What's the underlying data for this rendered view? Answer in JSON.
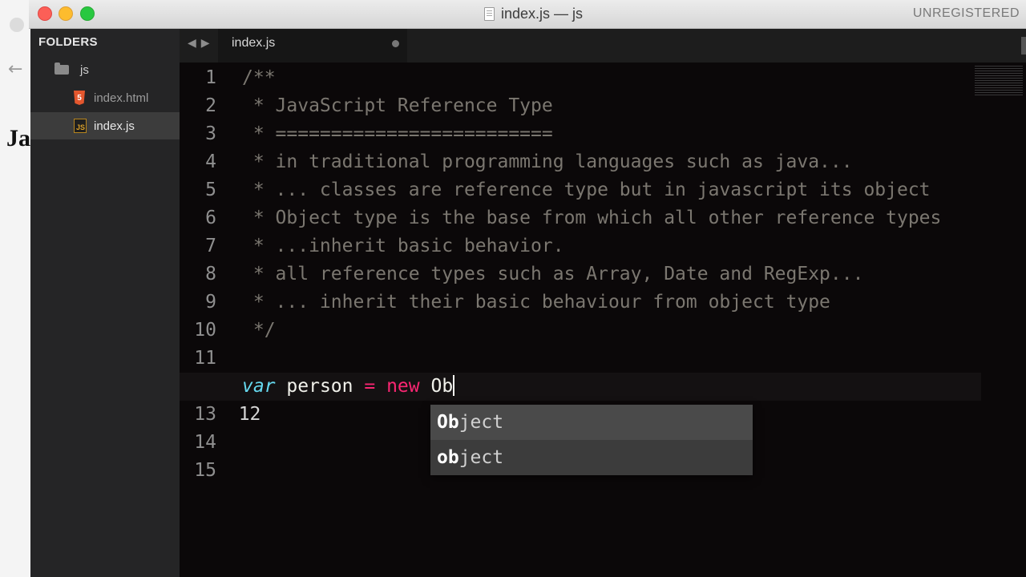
{
  "window": {
    "title": "index.js — js",
    "license_status": "UNREGISTERED"
  },
  "background": {
    "page_text": "Ja"
  },
  "sidebar": {
    "header": "FOLDERS",
    "items": [
      {
        "label": "js",
        "icon": "folder-icon"
      },
      {
        "label": "index.html",
        "icon": "html5-icon"
      },
      {
        "label": "index.js",
        "icon": "js-file-icon",
        "selected": true
      }
    ]
  },
  "tabs": [
    {
      "label": "index.js",
      "dirty": true
    }
  ],
  "editor": {
    "active_line": 12,
    "lines": [
      {
        "n": "1",
        "text": "/**"
      },
      {
        "n": "2",
        "text": " * JavaScript Reference Type"
      },
      {
        "n": "3",
        "text": " * ========================="
      },
      {
        "n": "4",
        "text": " * in traditional programming languages such as java..."
      },
      {
        "n": "5",
        "text": " * ... classes are reference type but in javascript its object"
      },
      {
        "n": "6",
        "text": " * Object type is the base from which all other reference types"
      },
      {
        "n": "7",
        "text": " * ...inherit basic behavior."
      },
      {
        "n": "8",
        "text": " * all reference types such as Array, Date and RegExp..."
      },
      {
        "n": "9",
        "text": " * ... inherit their basic behaviour from object type"
      },
      {
        "n": "10",
        "text": " */"
      },
      {
        "n": "11",
        "text": ""
      },
      {
        "n": "12",
        "tokens": {
          "kw": "var",
          "ident": "person",
          "op_eq": "=",
          "op_new": "new",
          "typed": "Ob"
        }
      },
      {
        "n": "13",
        "text": ""
      },
      {
        "n": "14",
        "text": ""
      },
      {
        "n": "15",
        "text": ""
      }
    ]
  },
  "autocomplete": {
    "items": [
      {
        "match": "Ob",
        "rest": "ject"
      },
      {
        "match": "ob",
        "rest": "ject"
      }
    ]
  },
  "colors": {
    "comment": "#7b7770",
    "keyword": "#66d9ef",
    "operator": "#f92672",
    "editor_bg": "#0b0809"
  }
}
